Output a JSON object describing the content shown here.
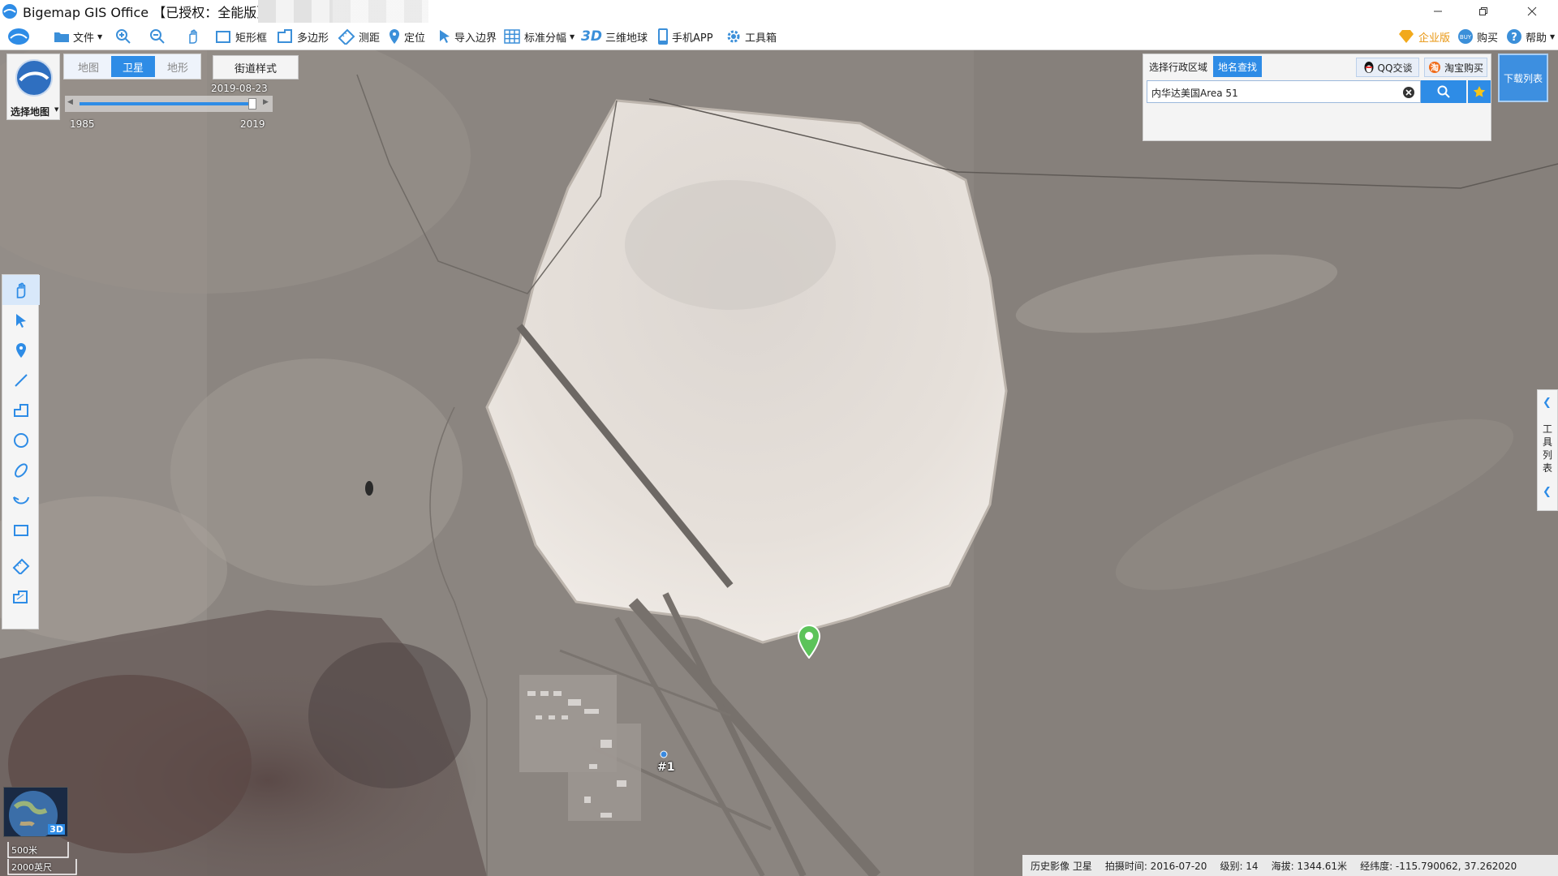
{
  "app": {
    "title": "Bigemap GIS Office 【已授权：全能版】"
  },
  "toolbar": {
    "file": "文件",
    "rect": "矩形框",
    "polygon": "多边形",
    "measure": "测距",
    "locate": "定位",
    "import_border": "导入边界",
    "grid": "标准分幅",
    "three_d": "3D",
    "globe": "三维地球",
    "mobile": "手机APP",
    "toolbox": "工具箱",
    "enterprise": "企业版",
    "buy": "购买",
    "help": "帮助"
  },
  "map_select": {
    "label": "选择地图"
  },
  "map_tabs": [
    {
      "label": "地图"
    },
    {
      "label": "卫星"
    },
    {
      "label": "地形"
    }
  ],
  "street_style": "街道样式",
  "timeline": {
    "date": "2019-08-23",
    "start": "1985",
    "end": "2019"
  },
  "search_panel": {
    "tabs": [
      {
        "label": "选择行政区域"
      },
      {
        "label": "地名查找"
      }
    ],
    "qq": "QQ交谈",
    "taobao": "淘宝购买",
    "query": "内华达美国Area 51"
  },
  "download_list": "下载列表",
  "right_panel": {
    "label": "工具列表"
  },
  "marker_label": "#1",
  "scale": {
    "metric": "500米",
    "imperial": "2000英尺"
  },
  "globe_3d": "3D",
  "status": {
    "imagery": "历史影像 卫星",
    "capture_time": "拍摄时间: 2016-07-20",
    "level": "级别:  14",
    "elevation": "海拔: 1344.61米",
    "coords": "经纬度:   -115.790062, 37.262020"
  },
  "colors": {
    "accent": "#2e8ce6",
    "marker": "#5cc35a",
    "desert": "#8d8781",
    "lakebed": "#e2dcd6"
  }
}
